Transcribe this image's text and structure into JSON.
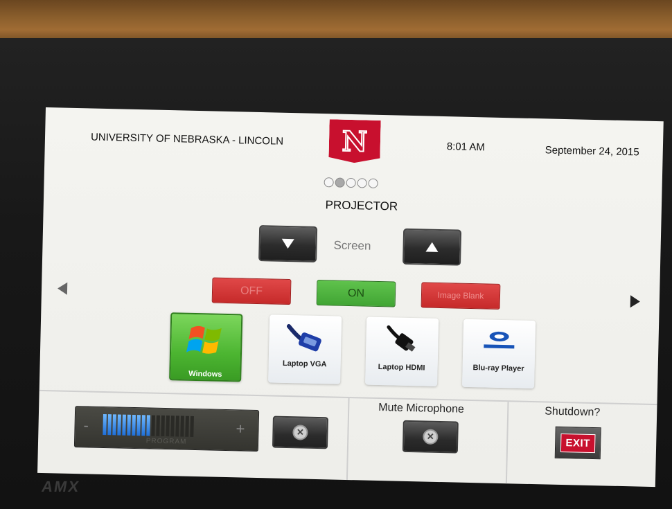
{
  "header": {
    "university": "UNIVERSITY OF NEBRASKA - LINCOLN",
    "logo_letter": "N",
    "time": "8:01 AM",
    "date": "September 24, 2015"
  },
  "pager": {
    "total": 5,
    "active": 2
  },
  "page_title": "PROJECTOR",
  "screen_control": {
    "label": "Screen"
  },
  "power": {
    "off": "OFF",
    "on": "ON",
    "image_blank": "Image Blank"
  },
  "sources": [
    {
      "label": "Windows",
      "icon": "windows-icon",
      "selected": true
    },
    {
      "label": "Laptop VGA",
      "icon": "vga-cable-icon",
      "selected": false
    },
    {
      "label": "Laptop HDMI",
      "icon": "hdmi-cable-icon",
      "selected": false
    },
    {
      "label": "Blu-ray Player",
      "icon": "bluray-icon",
      "selected": false
    }
  ],
  "volume": {
    "minus": "-",
    "plus": "+",
    "label": "PROGRAM",
    "level_bars": 10,
    "total_bars": 19
  },
  "microphone": {
    "label": "Mute Microphone"
  },
  "shutdown": {
    "label": "Shutdown?",
    "exit": "EXIT"
  },
  "colors": {
    "accent_red": "#c8102e",
    "on_green": "#4cb531",
    "volume_blue": "#1f6fd8"
  }
}
